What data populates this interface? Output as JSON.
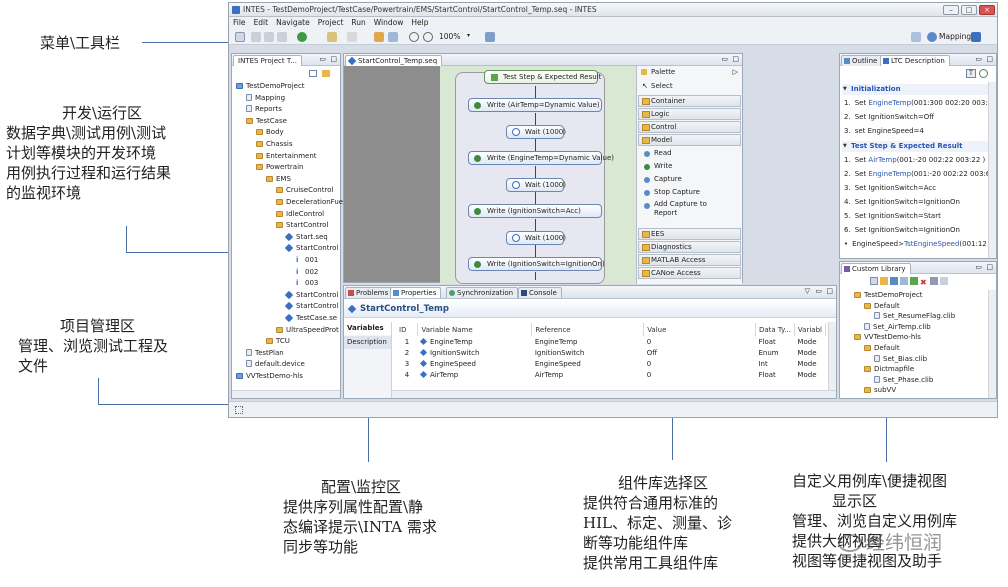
{
  "window": {
    "title": "INTES - TestDemoProject/TestCase/Powertrain/EMS/StartControl/StartControl_Temp.seq - INTES",
    "zoom": "100%",
    "mapping_label": "Mapping"
  },
  "menu": [
    "File",
    "Edit",
    "Navigate",
    "Project",
    "Run",
    "Window",
    "Help"
  ],
  "project_panel": {
    "tab": "INTES Project T...",
    "items": [
      {
        "label": "TestDemoProject",
        "icon": "proj",
        "indent": 0
      },
      {
        "label": "Mapping",
        "icon": "file",
        "indent": 1
      },
      {
        "label": "Reports",
        "icon": "file",
        "indent": 1
      },
      {
        "label": "TestCase",
        "icon": "folder",
        "indent": 1
      },
      {
        "label": "Body",
        "icon": "folder",
        "indent": 2
      },
      {
        "label": "Chassis",
        "icon": "folder",
        "indent": 2
      },
      {
        "label": "Entertainment",
        "icon": "folder",
        "indent": 2
      },
      {
        "label": "Powertrain",
        "icon": "folder",
        "indent": 2
      },
      {
        "label": "EMS",
        "icon": "folder",
        "indent": 3
      },
      {
        "label": "CruiseControl",
        "icon": "folder",
        "indent": 4
      },
      {
        "label": "DecelerationFue",
        "icon": "folder",
        "indent": 4
      },
      {
        "label": "IdleControl",
        "icon": "folder",
        "indent": 4
      },
      {
        "label": "StartControl",
        "icon": "folder",
        "indent": 4
      },
      {
        "label": "Start.seq",
        "icon": "diamond",
        "indent": 5
      },
      {
        "label": "StartControl",
        "icon": "diamond",
        "indent": 5
      },
      {
        "label": "001",
        "icon": "info",
        "indent": 6
      },
      {
        "label": "002",
        "icon": "info",
        "indent": 6
      },
      {
        "label": "003",
        "icon": "info",
        "indent": 6
      },
      {
        "label": "StartControl",
        "icon": "diamond",
        "indent": 5
      },
      {
        "label": "StartControl",
        "icon": "diamond",
        "indent": 5
      },
      {
        "label": "TestCase.se",
        "icon": "diamond",
        "indent": 5
      },
      {
        "label": "UltraSpeedProt",
        "icon": "folder",
        "indent": 4
      },
      {
        "label": "TCU",
        "icon": "folder",
        "indent": 3
      },
      {
        "label": "TestPlan",
        "icon": "file",
        "indent": 1
      },
      {
        "label": "default.device",
        "icon": "file",
        "indent": 1
      },
      {
        "label": "VVTestDemo-hls",
        "icon": "proj",
        "indent": 0
      }
    ]
  },
  "editor": {
    "tab": "StartControl_Temp.seq",
    "header": "Test Step & Expected Result",
    "steps": [
      {
        "label": "Write (AirTemp=Dynamic Value)",
        "kind": "write"
      },
      {
        "label": "Wait (1000)",
        "kind": "wait"
      },
      {
        "label": "Write (EngineTemp=Dynamic Value)",
        "kind": "write"
      },
      {
        "label": "Wait (1000)",
        "kind": "wait"
      },
      {
        "label": "Write (IgnitionSwitch=Acc)",
        "kind": "write"
      },
      {
        "label": "Wait (1000)",
        "kind": "wait"
      },
      {
        "label": "Write (IgnitionSwitch=IgnitionOn)",
        "kind": "write"
      }
    ]
  },
  "palette": {
    "title": "Palette",
    "select": "Select",
    "categories_top": [
      "Container",
      "Logic",
      "Control",
      "Model"
    ],
    "model_items": [
      "Read",
      "Write",
      "Capture",
      "Stop Capture",
      "Add Capture to Report"
    ],
    "categories_bottom": [
      "EES",
      "Diagnostics",
      "MATLAB Access",
      "CANoe Access"
    ]
  },
  "outline_panel": {
    "tabs": [
      "Outline",
      "LTC Description"
    ],
    "sections": [
      {
        "title": "Initialization",
        "lines": [
          {
            "num": "1.",
            "pre": "Set ",
            "hl": "EngineTemp",
            "post": "(001:300 002:20 003:1"
          },
          {
            "num": "2.",
            "pre": "Set IgnitionSwitch=Off",
            "hl": "",
            "post": ""
          },
          {
            "num": "3.",
            "pre": "set EngineSpeed=4",
            "hl": "",
            "post": ""
          }
        ]
      },
      {
        "title": "Test Step & Expected Result",
        "lines": [
          {
            "num": "1.",
            "pre": "Set ",
            "hl": "AirTemp",
            "post": "(001:-20 002:22 003:22 )"
          },
          {
            "num": "2.",
            "pre": "Set ",
            "hl": "EngineTemp",
            "post": "(001:-20 002:22 003:6("
          },
          {
            "num": "3.",
            "pre": "Set IgnitionSwitch=Acc",
            "hl": "",
            "post": ""
          },
          {
            "num": "4.",
            "pre": "Set IgnitionSwitch=IgnitionOn",
            "hl": "",
            "post": ""
          },
          {
            "num": "5.",
            "pre": "Set IgnitionSwitch=Start",
            "hl": "",
            "post": ""
          },
          {
            "num": "6.",
            "pre": "Set IgnitionSwitch=IgnitionOn",
            "hl": "",
            "post": ""
          },
          {
            "num": "•",
            "pre": "EngineSpeed>",
            "hl": "TstEngineSpeed",
            "post": "(001:12"
          }
        ]
      }
    ]
  },
  "custom_library": {
    "tab": "Custom Library",
    "items": [
      {
        "label": "TestDemoProject",
        "icon": "folder",
        "indent": 0
      },
      {
        "label": "Default",
        "icon": "folder",
        "indent": 1
      },
      {
        "label": "Set_ResumeFlag.clib",
        "icon": "file",
        "indent": 2
      },
      {
        "label": "Set_AirTemp.clib",
        "icon": "file",
        "indent": 1
      },
      {
        "label": "VVTestDemo-hls",
        "icon": "folder",
        "indent": 0
      },
      {
        "label": "Default",
        "icon": "folder",
        "indent": 1
      },
      {
        "label": "Set_Bias.clib",
        "icon": "file",
        "indent": 2
      },
      {
        "label": "Dictmapfile",
        "icon": "folder",
        "indent": 1
      },
      {
        "label": "Set_Phase.clib",
        "icon": "file",
        "indent": 2
      },
      {
        "label": "subVV",
        "icon": "folder",
        "indent": 1
      }
    ]
  },
  "properties_panel": {
    "tabs": [
      "Problems",
      "Properties",
      "Synchronization",
      "Console"
    ],
    "title": "StartControl_Temp",
    "side_tabs": [
      "Variables",
      "Description"
    ],
    "columns": [
      "ID",
      "Variable Name",
      "Reference",
      "Value",
      "Data Ty...",
      "Variabl"
    ],
    "rows": [
      [
        "1",
        "EngineTemp",
        "EngineTemp",
        "0",
        "Float",
        "Mode"
      ],
      [
        "2",
        "IgnitionSwitch",
        "IgnitionSwitch",
        "Off",
        "Enum",
        "Mode"
      ],
      [
        "3",
        "EngineSpeed",
        "EngineSpeed",
        "0",
        "Int",
        "Mode"
      ],
      [
        "4",
        "AirTemp",
        "AirTemp",
        "0",
        "Float",
        "Mode"
      ]
    ]
  },
  "annotations": {
    "menu_toolbar": "菜单\\工具栏",
    "dev_area": [
      "开发\\运行区",
      "数据字典\\测试用例\\测试",
      "计划等模块的开发环境",
      "用例执行过程和运行结果",
      "的监视环境"
    ],
    "project_area": [
      "项目管理区",
      "管理、浏览测试工程及",
      "文件"
    ],
    "config_area": [
      "配置\\监控区",
      "提供序列属性配置\\静",
      "态编译提示\\INTA 需求",
      "同步等功能"
    ],
    "component_area": [
      "组件库选择区",
      "提供符合通用标准的",
      "HIL、标定、测量、诊",
      "断等功能组件库",
      "提供常用工具组件库"
    ],
    "custom_area": [
      "自定义用例库\\便捷视图",
      "显示区",
      "管理、浏览自定义用例库",
      "提供大纲视图",
      "视图等便捷视图及助手"
    ],
    "watermark": "经纬恒润"
  }
}
